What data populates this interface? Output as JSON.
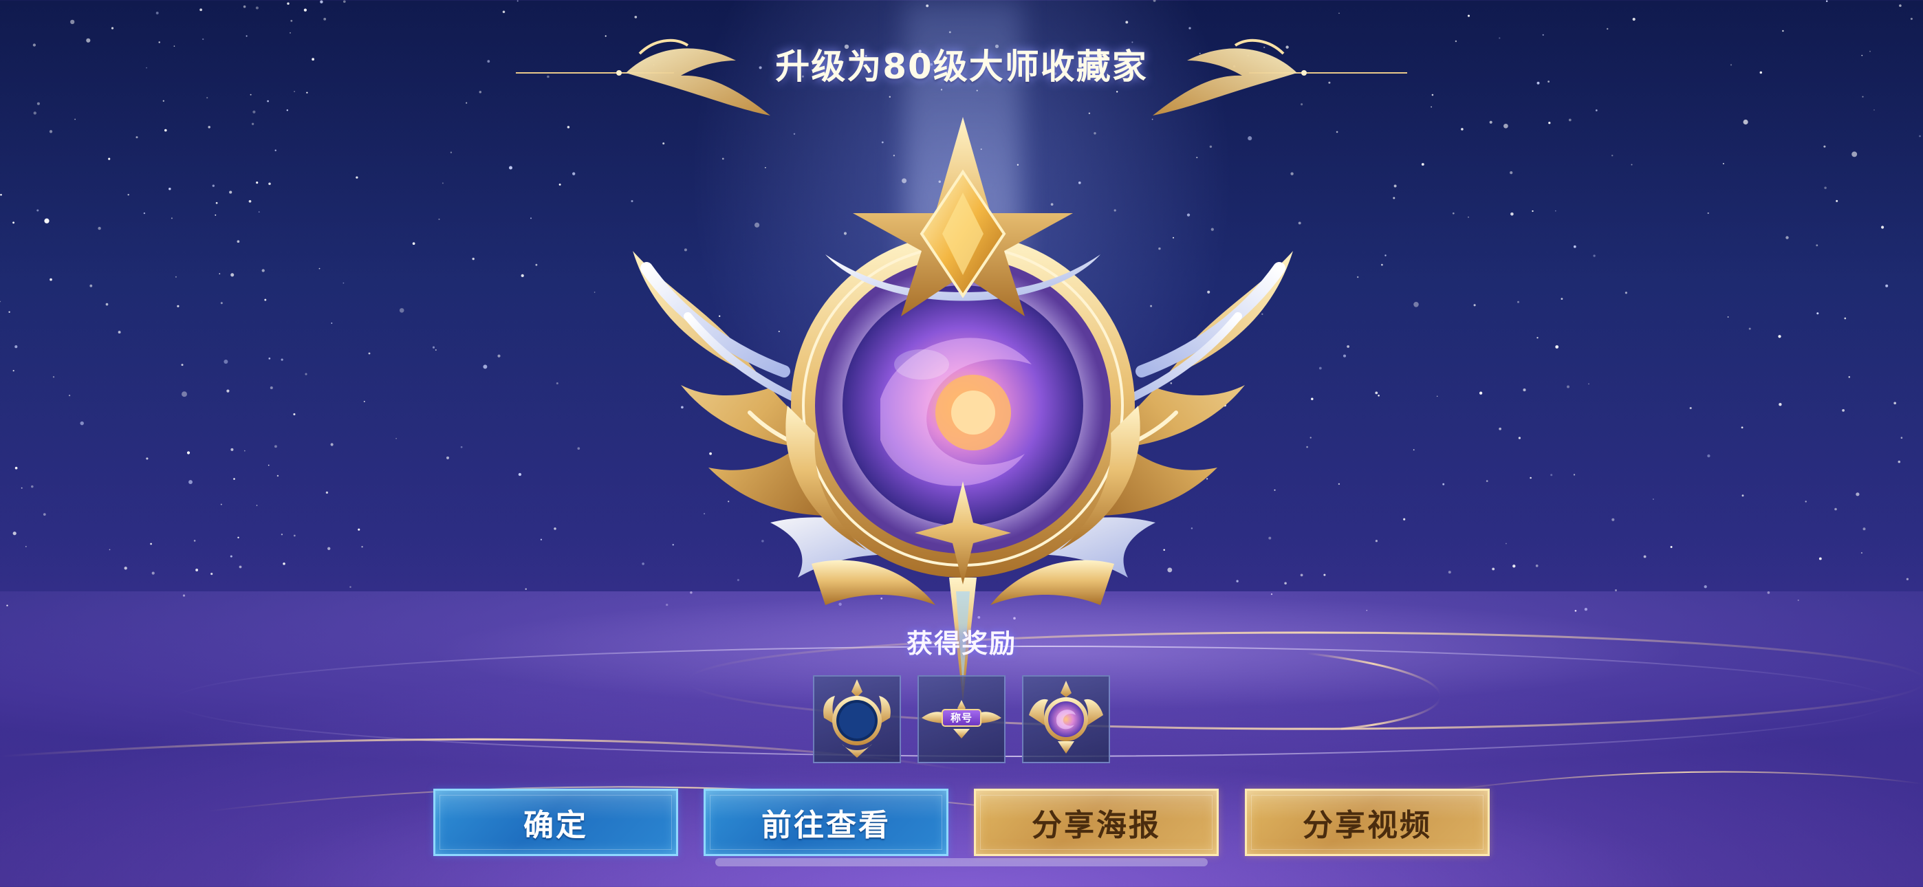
{
  "title": "升级为80级大师收藏家",
  "rewards": {
    "label": "获得奖励",
    "items": [
      {
        "icon": "avatar-frame-icon"
      },
      {
        "icon": "title-badge-icon",
        "tag_text": "称号"
      },
      {
        "icon": "emblem-orb-icon"
      }
    ]
  },
  "buttons": {
    "confirm": "确定",
    "go_view": "前往查看",
    "share_poster": "分享海报",
    "share_video": "分享视频"
  },
  "colors": {
    "accent_blue": "#2f8fd6",
    "accent_gold": "#e0b560",
    "title_text": "#fffbe9"
  }
}
